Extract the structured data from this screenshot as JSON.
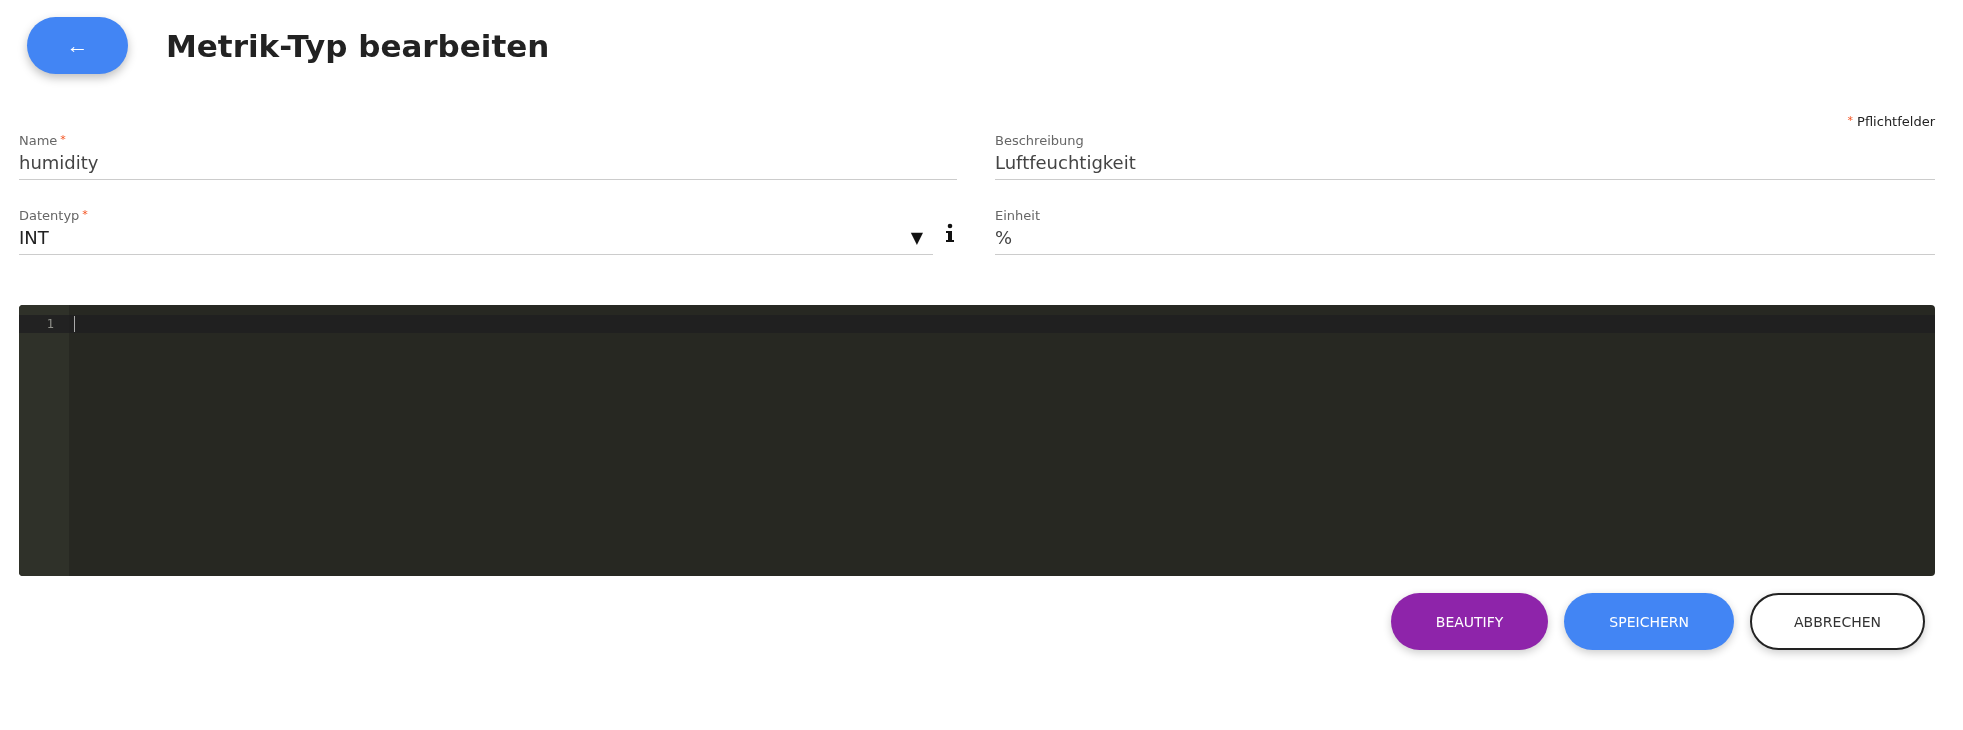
{
  "header": {
    "back_button": "←",
    "title": "Metrik-Typ bearbeiten"
  },
  "required_note": {
    "mark": "*",
    "label": "Pflichtfelder"
  },
  "fields": [
    {
      "kind": "text",
      "label": "Name",
      "required": true,
      "value": "humidity"
    },
    {
      "kind": "text",
      "label": "Beschreibung",
      "required": false,
      "value": "Luftfeuchtigkeit"
    },
    {
      "kind": "select",
      "label": "Datentyp",
      "required": true,
      "value": "INT",
      "caret": "▼"
    },
    {
      "kind": "text",
      "label": "Einheit",
      "required": false,
      "value": "%"
    }
  ],
  "editor": {
    "line_numbers": [
      "1"
    ]
  },
  "buttons": [
    {
      "kind": "beautify",
      "label": "BEAUTIFY"
    },
    {
      "kind": "primary",
      "label": "SPEICHERN"
    },
    {
      "kind": "outline",
      "label": "ABBRECHEN"
    }
  ]
}
